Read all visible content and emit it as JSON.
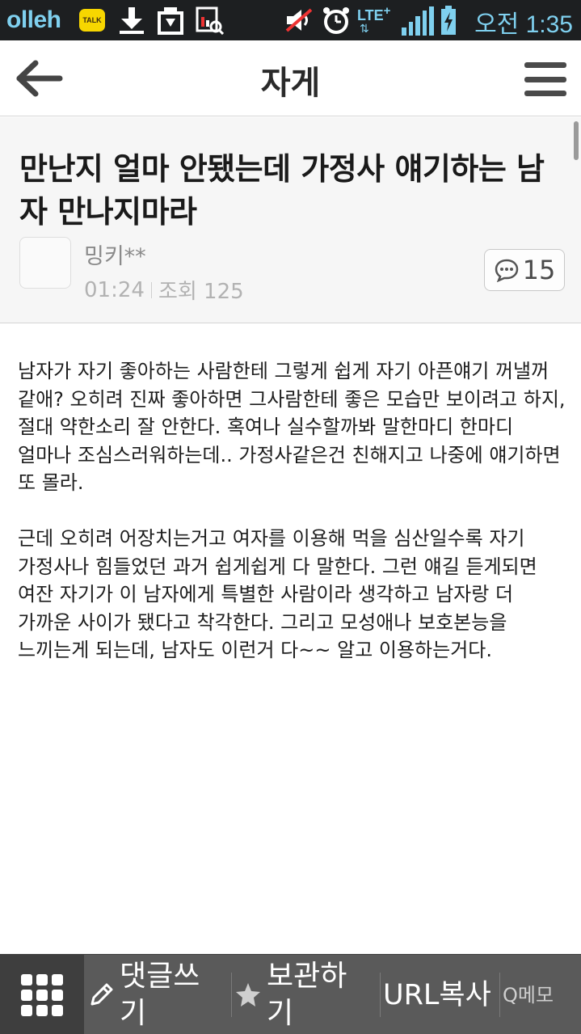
{
  "status_bar": {
    "carrier": "olleh",
    "talk_badge": "TALK",
    "network": "LTE",
    "network_plus": "+",
    "time": "오전 1:35",
    "icons": [
      "kakaotalk-icon",
      "download-icon",
      "install-icon",
      "screenshot-icon",
      "mute-icon",
      "alarm-icon",
      "lte-icon",
      "signal-icon",
      "battery-charging-icon"
    ]
  },
  "header": {
    "title": "자게"
  },
  "post": {
    "title": "만난지 얼마 안됐는데 가정사 얘기하는 남자 만나지마라",
    "author": "밍키**",
    "time": "01:24",
    "views_label": "조회 125",
    "comment_count": "15"
  },
  "content": {
    "paragraphs": [
      "남자가 자기 좋아하는 사람한테 그렇게 쉽게 자기 아픈얘기 꺼낼꺼 같애? 오히려 진짜 좋아하면 그사람한테 좋은 모습만 보이려고 하지, 절대 약한소리 잘 안한다. 혹여나 실수할까봐 말한마디 한마디 얼마나 조심스러워하는데.. 가정사같은건 친해지고 나중에 얘기하면 또 몰라.",
      "근데 오히려 어장치는거고 여자를 이용해 먹을 심산일수록 자기 가정사나 힘들었던 과거 쉽게쉽게 다 말한다. 그런 얘길 듣게되면 여잔 자기가 이 남자에게 특별한 사람이라 생각하고 남자랑 더 가까운 사이가 됐다고 착각한다. 그리고 모성애나 보호본능을 느끼는게 되는데, 남자도 이런거 다~~ 알고 이용하는거다."
    ]
  },
  "bottom_bar": {
    "write_comment": "댓글쓰기",
    "bookmark": "보관하기",
    "copy_url": "URL복사",
    "qmemo": "Q메모"
  }
}
